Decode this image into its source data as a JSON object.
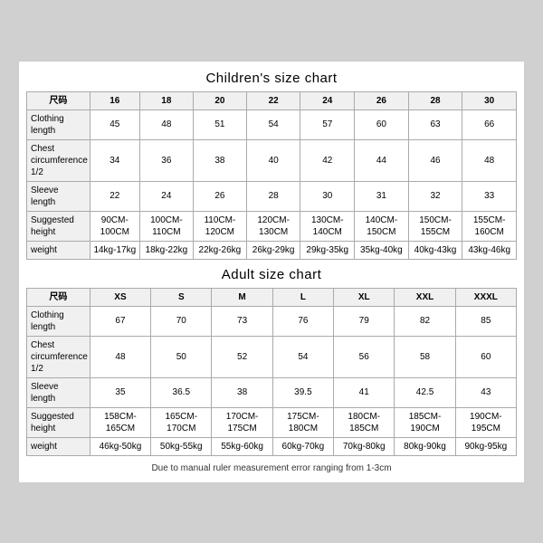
{
  "children_chart": {
    "title": "Children's size chart",
    "columns": [
      "尺码",
      "16",
      "18",
      "20",
      "22",
      "24",
      "26",
      "28",
      "30"
    ],
    "rows": [
      {
        "label": "Clothing\nlength",
        "values": [
          "45",
          "48",
          "51",
          "54",
          "57",
          "60",
          "63",
          "66"
        ]
      },
      {
        "label": "Chest\ncircumference\n1/2",
        "values": [
          "34",
          "36",
          "38",
          "40",
          "42",
          "44",
          "46",
          "48"
        ]
      },
      {
        "label": "Sleeve\nlength",
        "values": [
          "22",
          "24",
          "26",
          "28",
          "30",
          "31",
          "32",
          "33"
        ]
      },
      {
        "label": "Suggested\nheight",
        "values": [
          "90CM-100CM",
          "100CM-110CM",
          "110CM-120CM",
          "120CM-130CM",
          "130CM-140CM",
          "140CM-150CM",
          "150CM-155CM",
          "155CM-160CM"
        ]
      },
      {
        "label": "weight",
        "values": [
          "14kg-17kg",
          "18kg-22kg",
          "22kg-26kg",
          "26kg-29kg",
          "29kg-35kg",
          "35kg-40kg",
          "40kg-43kg",
          "43kg-46kg"
        ]
      }
    ]
  },
  "adult_chart": {
    "title": "Adult size chart",
    "columns": [
      "尺码",
      "XS",
      "S",
      "M",
      "L",
      "XL",
      "XXL",
      "XXXL"
    ],
    "rows": [
      {
        "label": "Clothing\nlength",
        "values": [
          "67",
          "70",
          "73",
          "76",
          "79",
          "82",
          "85"
        ]
      },
      {
        "label": "Chest\ncircumference\n1/2",
        "values": [
          "48",
          "50",
          "52",
          "54",
          "56",
          "58",
          "60"
        ]
      },
      {
        "label": "Sleeve\nlength",
        "values": [
          "35",
          "36.5",
          "38",
          "39.5",
          "41",
          "42.5",
          "43"
        ]
      },
      {
        "label": "Suggested\nheight",
        "values": [
          "158CM-165CM",
          "165CM-170CM",
          "170CM-175CM",
          "175CM-180CM",
          "180CM-185CM",
          "185CM-190CM",
          "190CM-195CM"
        ]
      },
      {
        "label": "weight",
        "values": [
          "46kg-50kg",
          "50kg-55kg",
          "55kg-60kg",
          "60kg-70kg",
          "70kg-80kg",
          "80kg-90kg",
          "90kg-95kg"
        ]
      }
    ]
  },
  "footnote": "Due to manual ruler measurement error ranging from 1-3cm"
}
